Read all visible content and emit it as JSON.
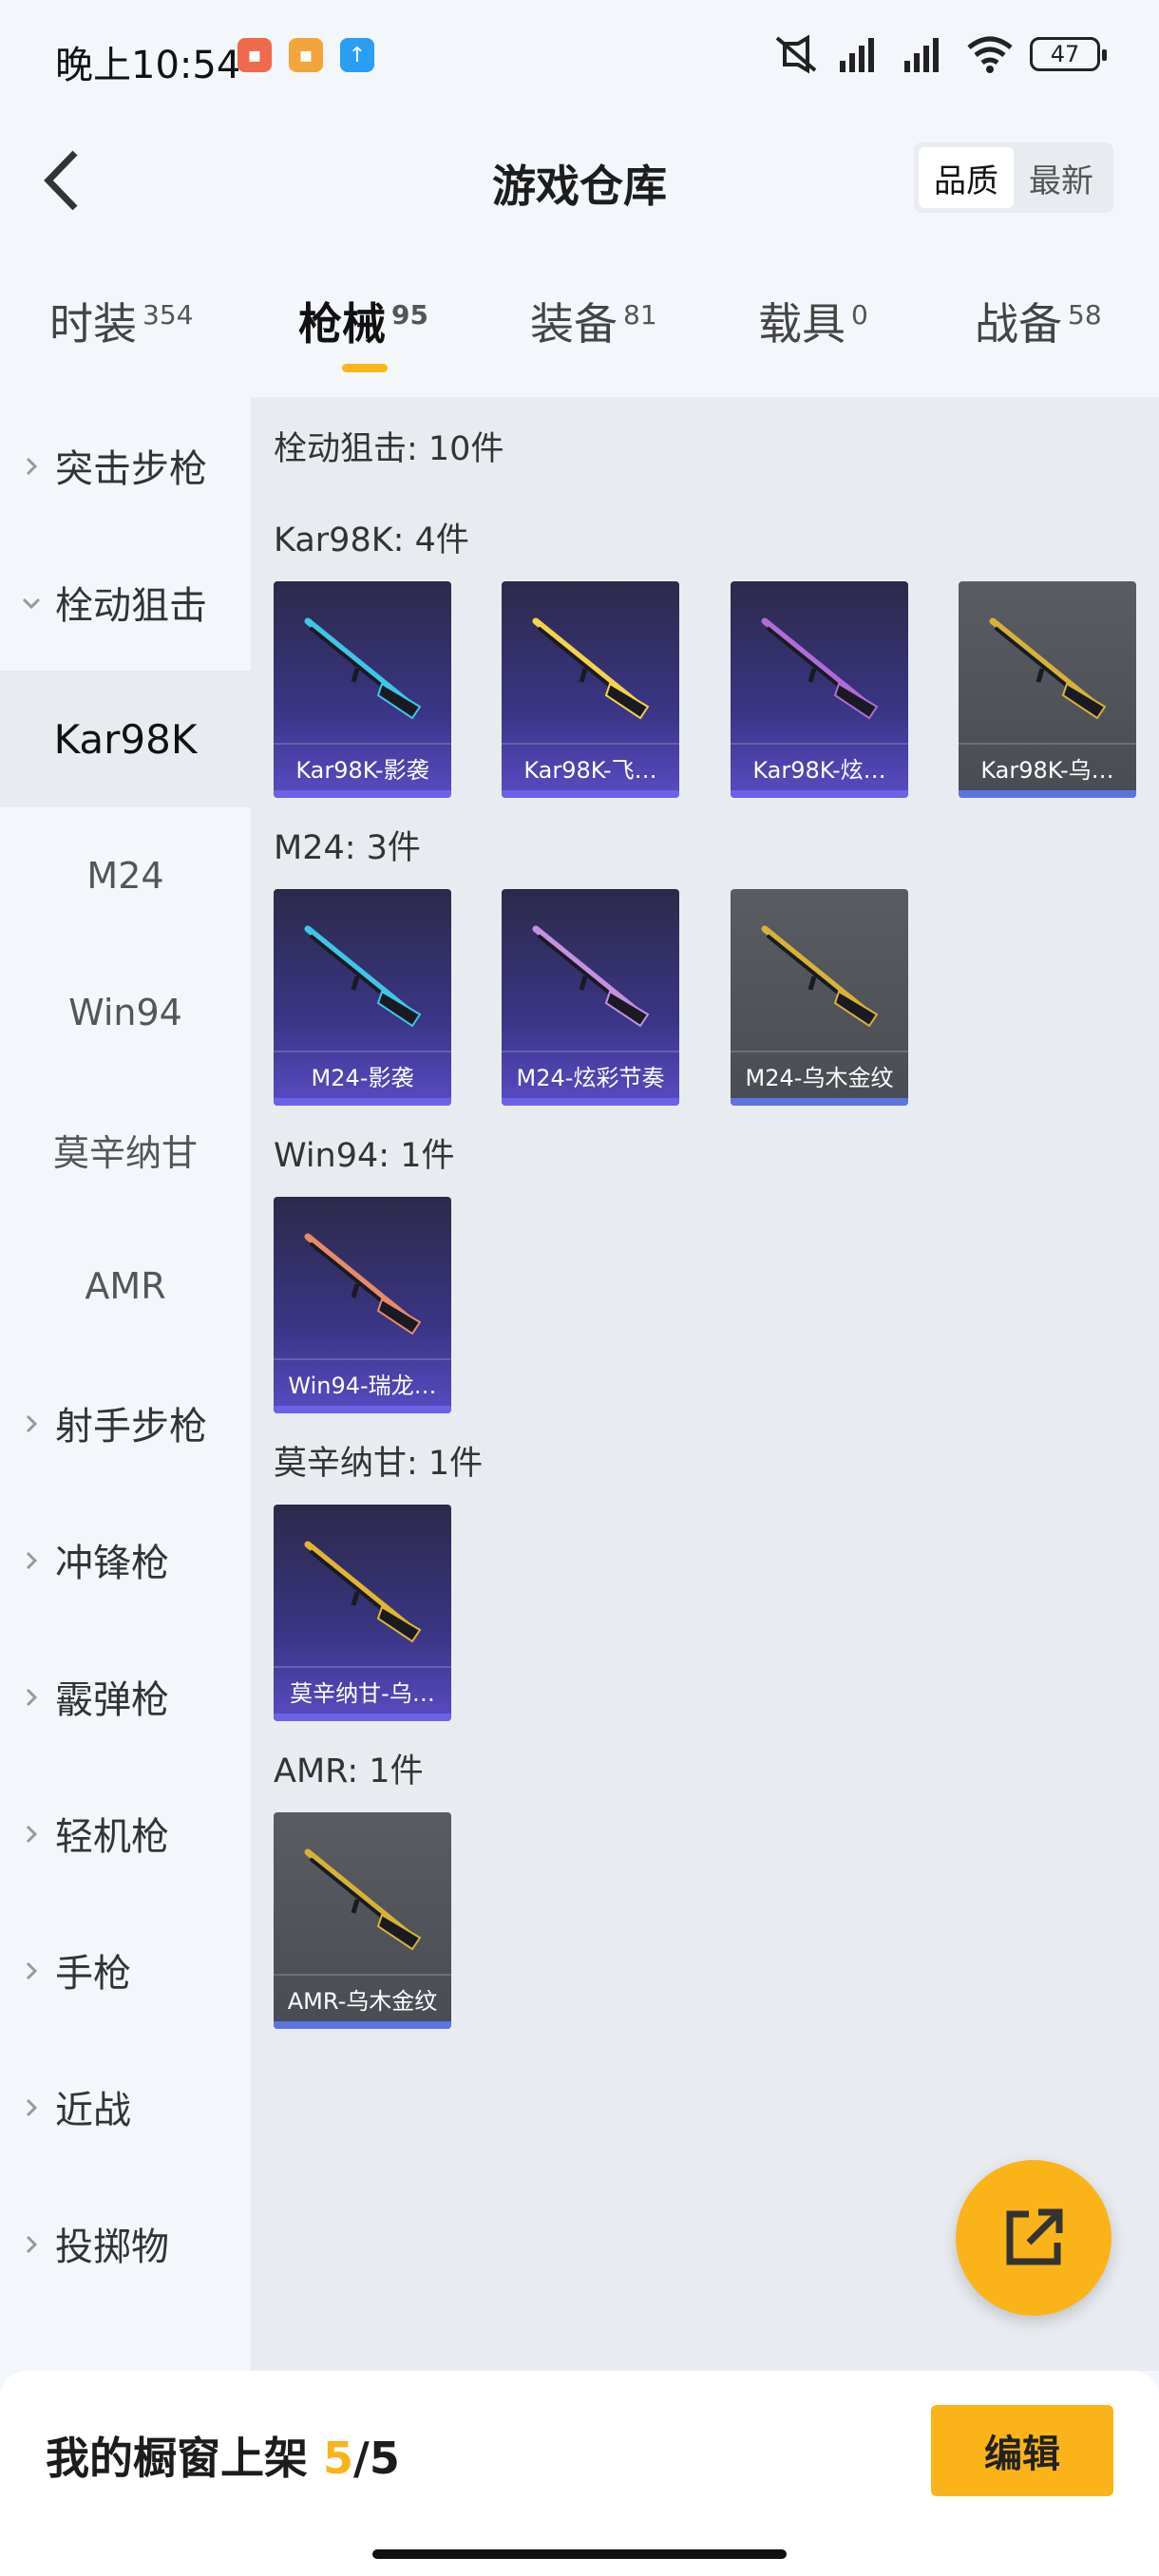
{
  "status_bar": {
    "time": "晚上10:54",
    "battery": "47",
    "app_icons": [
      {
        "name": "red-app-icon",
        "color": "#ee6a4a"
      },
      {
        "name": "folder-app-icon",
        "color": "#f3a43a"
      },
      {
        "name": "upload-app-icon",
        "color": "#2a9df4"
      }
    ]
  },
  "header": {
    "title": "游戏仓库",
    "sort_options": [
      "品质",
      "最新"
    ],
    "active_sort": "品质"
  },
  "tabs": [
    {
      "label": "时装",
      "count": "354",
      "active": false
    },
    {
      "label": "枪械",
      "count": "95",
      "active": true
    },
    {
      "label": "装备",
      "count": "81",
      "active": false
    },
    {
      "label": "载具",
      "count": "0",
      "active": false
    },
    {
      "label": "战备",
      "count": "58",
      "active": false
    }
  ],
  "sidebar": {
    "items": [
      {
        "label": "突击步枪",
        "type": "group",
        "expanded": false
      },
      {
        "label": "栓动狙击",
        "type": "group",
        "expanded": true
      },
      {
        "label": "Kar98K",
        "type": "sub",
        "selected": true
      },
      {
        "label": "M24",
        "type": "sub"
      },
      {
        "label": "Win94",
        "type": "sub"
      },
      {
        "label": "莫辛纳甘",
        "type": "sub"
      },
      {
        "label": "AMR",
        "type": "sub"
      },
      {
        "label": "射手步枪",
        "type": "group",
        "expanded": false
      },
      {
        "label": "冲锋枪",
        "type": "group",
        "expanded": false
      },
      {
        "label": "霰弹枪",
        "type": "group",
        "expanded": false
      },
      {
        "label": "轻机枪",
        "type": "group",
        "expanded": false
      },
      {
        "label": "手枪",
        "type": "group",
        "expanded": false
      },
      {
        "label": "近战",
        "type": "group",
        "expanded": false
      },
      {
        "label": "投掷物",
        "type": "group",
        "expanded": false
      }
    ]
  },
  "content": {
    "category_title": "栓动狙击: 10件",
    "sections": [
      {
        "title": "Kar98K: 4件",
        "items": [
          {
            "label": "Kar98K-影袭",
            "rarity": "purple",
            "weapon_color": "#3ec6e8"
          },
          {
            "label": "Kar98K-飞…",
            "rarity": "purple",
            "weapon_color": "#f3d34a"
          },
          {
            "label": "Kar98K-炫…",
            "rarity": "purple",
            "weapon_color": "#b06bd8"
          },
          {
            "label": "Kar98K-乌…",
            "rarity": "gray",
            "weapon_color": "#d7b235"
          }
        ]
      },
      {
        "title": "M24: 3件",
        "items": [
          {
            "label": "M24-影袭",
            "rarity": "purple",
            "weapon_color": "#3ec6e8"
          },
          {
            "label": "M24-炫彩节奏",
            "rarity": "purple",
            "weapon_color": "#c68fe0"
          },
          {
            "label": "M24-乌木金纹",
            "rarity": "gray",
            "weapon_color": "#d7b235"
          }
        ]
      },
      {
        "title": "Win94: 1件",
        "items": [
          {
            "label": "Win94-瑞龙…",
            "rarity": "purple",
            "weapon_color": "#e88a6a"
          }
        ]
      },
      {
        "title": "莫辛纳甘: 1件",
        "items": [
          {
            "label": "莫辛纳甘-乌…",
            "rarity": "purple",
            "weapon_color": "#e2b52f"
          }
        ]
      },
      {
        "title": "AMR: 1件",
        "items": [
          {
            "label": "AMR-乌木金纹",
            "rarity": "gray",
            "weapon_color": "#d7b235"
          }
        ]
      }
    ]
  },
  "bottom_bar": {
    "showcase_label": "我的橱窗上架",
    "showcase_current": "5",
    "showcase_separator": "/",
    "showcase_total": "5",
    "edit_label": "编辑"
  },
  "colors": {
    "accent": "#fbb31a",
    "rarity_purple": "#6b62e8",
    "rarity_gray": "#5d74e0"
  }
}
